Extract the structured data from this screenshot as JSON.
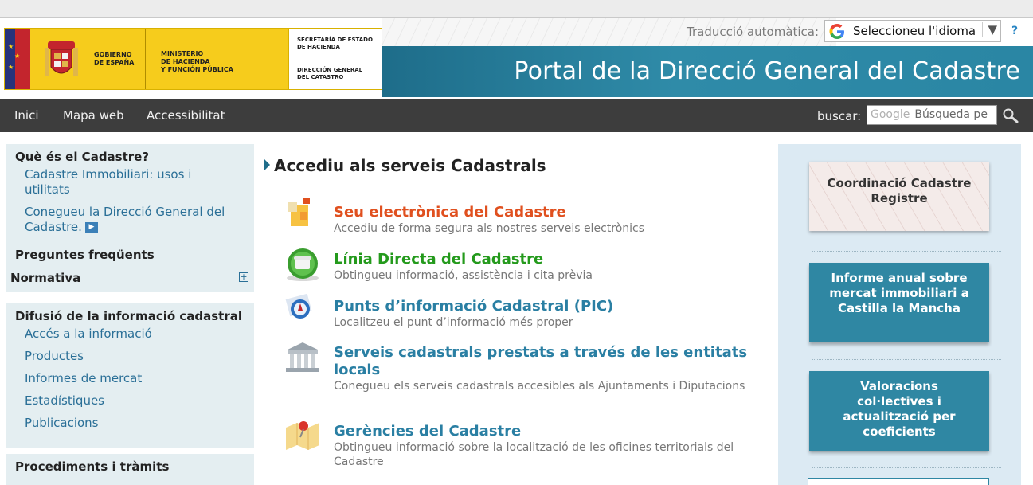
{
  "header": {
    "title": "Portal de la Direcció General del Cadastre",
    "logo": {
      "gov_line1": "GOBIERNO",
      "gov_line2": "DE ESPAÑA",
      "min_line1": "MINISTERIO",
      "min_line2": "DE HACIENDA",
      "min_line3": "Y FUNCIÓN PÚBLICA",
      "sec_line1": "SECRETARÍA DE ESTADO",
      "sec_line2": "DE HACIENDA",
      "dir_line1": "DIRECCIÓN GENERAL",
      "dir_line2": "DEL CATASTRO"
    },
    "translate_label": "Traducció automàtica:",
    "language_select": "Seleccioneu l'idioma",
    "help": "?"
  },
  "nav": {
    "items": [
      "Inici",
      "Mapa web",
      "Accessibilitat"
    ],
    "search_label": "buscar:",
    "search_brand": "Google",
    "search_placeholder": "Búsqueda pe"
  },
  "sidebar": {
    "box1": {
      "heading": "Què és el Cadastre?",
      "link1": "Cadastre Immobiliari: usos i utilitats",
      "link2": "Conegueu la Direcció General del Cadastre.",
      "faq": "Preguntes freqüents",
      "normativa": "Normativa"
    },
    "box2": {
      "heading": "Difusió de la informació cadastral",
      "links": [
        "Accés a la informació",
        "Productes",
        "Informes de mercat",
        "Estadístiques",
        "Publicacions"
      ]
    },
    "box3": {
      "heading": "Procediments i tràmits"
    }
  },
  "main": {
    "title": "Accediu als serveis Cadastrals",
    "services": [
      {
        "title": "Seu electrònica del Cadastre",
        "desc": "Accediu de forma segura als nostres serveis electrònics",
        "color": "#e0501f"
      },
      {
        "title": "Línia Directa del Cadastre",
        "desc": "Obtingueu informació, assistència i cita prèvia",
        "color": "#249a1c"
      },
      {
        "title": "Punts d’informació Cadastral (PIC)",
        "desc": "Localitzeu el punt d’informació més proper",
        "color": "#2a7fa3"
      },
      {
        "title": "Serveis cadastrals prestats a través de les entitats locals",
        "desc": "Conegueu els serveis cadastrals accesibles als Ajuntaments i Diputacions",
        "color": "#2a7fa3"
      },
      {
        "title": "Gerències del Cadastre",
        "desc": "Obtingueu informació sobre la localització de les oficines territorials del Cadastre",
        "color": "#2a7fa3"
      }
    ]
  },
  "right": {
    "promo1": "Coordinació Cadastre Registre",
    "promo2": "Informe anual sobre mercat immobiliari a Castilla la Mancha",
    "promo3": "Valoracions col·lectives i actualització per coeficients"
  },
  "colors": {
    "banner": "#2a86a4",
    "nav": "#3d3d3d",
    "sidebar": "#e4eef1",
    "link": "#2a6f97"
  }
}
